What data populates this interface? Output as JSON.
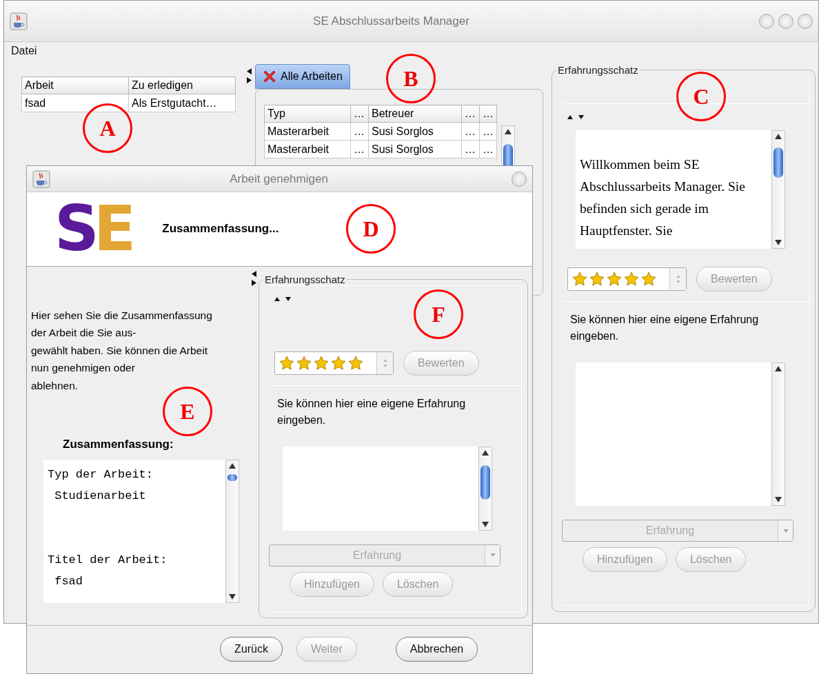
{
  "main_window": {
    "title": "SE Abschlussarbeits Manager",
    "menu": [
      "Datei"
    ],
    "todo_table": {
      "columns": [
        "Arbeit",
        "Zu erledigen"
      ],
      "rows": [
        [
          "fsad",
          "Als Erstgutacht…"
        ]
      ]
    },
    "tabs": [
      {
        "label": "Alle Arbeiten",
        "selected": true
      }
    ],
    "works_table": {
      "columns": [
        "Typ",
        "…",
        "Betreuer",
        "…",
        "…"
      ],
      "rows": [
        [
          "Masterarbeit",
          "…",
          "Susi Sorglos",
          "…",
          "…"
        ],
        [
          "Masterarbeit",
          "…",
          "Susi Sorglos",
          "…",
          "…"
        ]
      ]
    },
    "experience_panel": {
      "title": "Erfahrungsschatz",
      "welcome_text": "Willkommen beim SE Abschlussarbeits Manager. Sie befinden sich gerade im Hauptfenster. Sie",
      "rating": {
        "stars": 5
      },
      "rate_button": "Bewerten",
      "hint": "Sie können hier eine eigene Erfahrung eingeben.",
      "category": {
        "placeholder": "Erfahrung",
        "disabled": true
      },
      "buttons": [
        "Hinzufügen",
        "Löschen"
      ]
    }
  },
  "dialog": {
    "title": "Arbeit genehmigen",
    "logo": [
      "S",
      "E"
    ],
    "heading": "Zusammenfassung...",
    "intro": "Hier sehen Sie die Zusammenfassung\nder Arbeit die Sie aus-\ngewählt haben. Sie können die Arbeit\nnun genehmigen oder\nablehnen.",
    "summary_label": "Zusammenfassung:",
    "summary": "Typ der Arbeit:\n Studienarbeit\n\n\nTitel der Arbeit:\n fsad",
    "experience_panel": {
      "title": "Erfahrungsschatz",
      "rating": {
        "stars": 5
      },
      "rate_button": "Bewerten",
      "hint": "Sie können hier eine eigene Erfahrung eingeben.",
      "category": {
        "placeholder": "Erfahrung",
        "disabled": true
      },
      "buttons": [
        "Hinzufügen",
        "Löschen"
      ]
    },
    "buttons": [
      {
        "label": "Zurück",
        "disabled": false
      },
      {
        "label": "Weiter",
        "disabled": true
      },
      {
        "label": "Abbrechen",
        "disabled": false
      }
    ]
  },
  "callouts": [
    {
      "label": "A"
    },
    {
      "label": "B"
    },
    {
      "label": "C"
    },
    {
      "label": "D"
    },
    {
      "label": "E"
    },
    {
      "label": "F"
    }
  ]
}
